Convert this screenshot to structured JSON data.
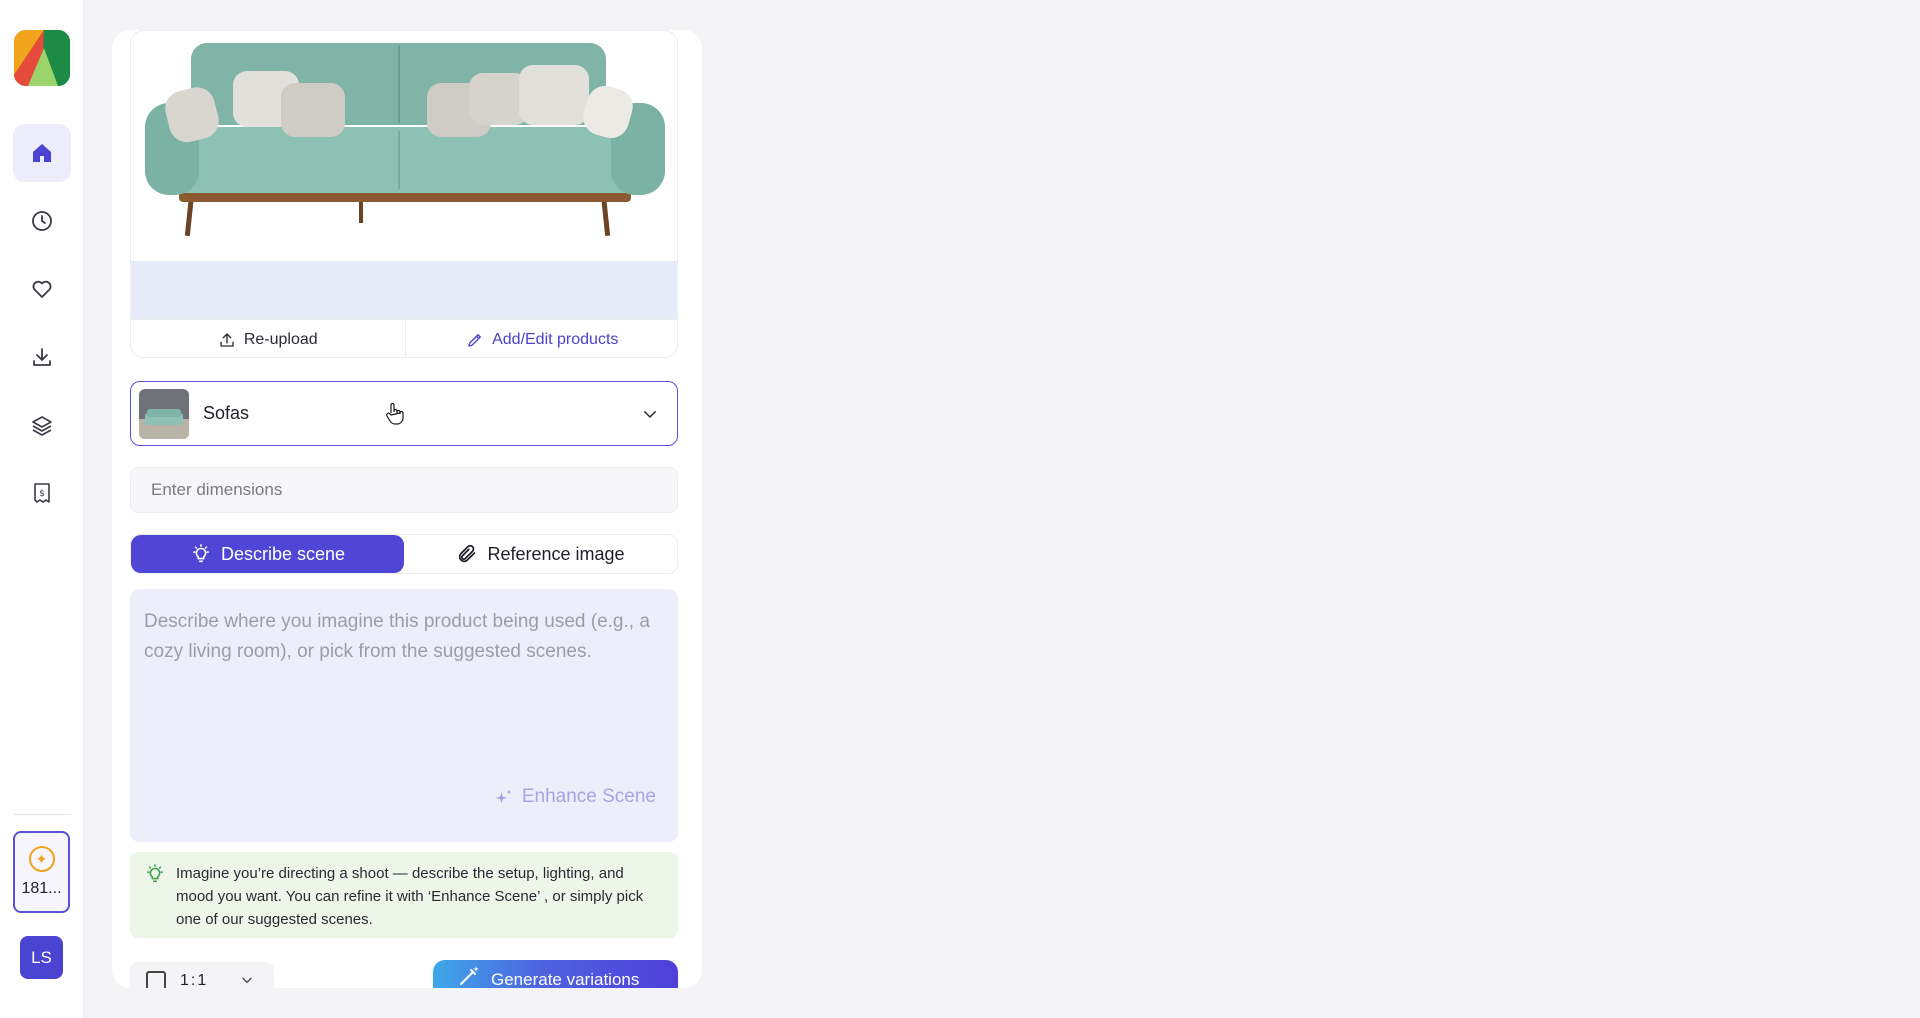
{
  "sidebar": {
    "nav": [
      {
        "icon": "home-icon",
        "active": true
      },
      {
        "icon": "clock-icon",
        "active": false
      },
      {
        "icon": "heart-icon",
        "active": false
      },
      {
        "icon": "download-icon",
        "active": false
      },
      {
        "icon": "layers-icon",
        "active": false
      },
      {
        "icon": "receipt-icon",
        "active": false
      }
    ],
    "credits": "181...",
    "avatar": "LS",
    "accent": "#4b43d1"
  },
  "product": {
    "reupload_label": "Re-upload",
    "edit_label": "Add/Edit products"
  },
  "category": {
    "selected": "Sofas"
  },
  "dimensions": {
    "placeholder": "Enter dimensions"
  },
  "tabs": [
    {
      "label": "Describe scene",
      "active": true
    },
    {
      "label": "Reference image",
      "active": false
    }
  ],
  "scene": {
    "placeholder": "Describe where you imagine this product being used (e.g., a cozy living room), or pick from the suggested scenes.",
    "enhance_label": "Enhance Scene"
  },
  "tip": {
    "text": "Imagine you’re directing a shoot — describe the setup, lighting, and mood you want. You can refine it with ‘Enhance Scene’ , or simply pick one of our suggested scenes."
  },
  "footer": {
    "ratio": "1:1",
    "generate_label": "Generate variations"
  }
}
